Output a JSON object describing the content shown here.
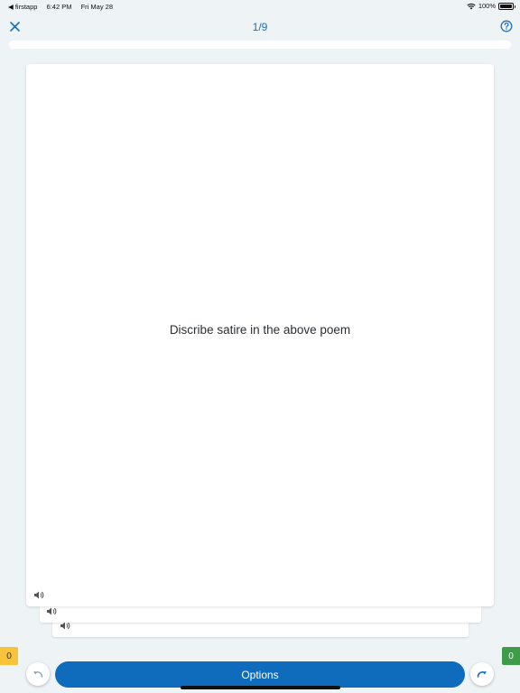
{
  "status_bar": {
    "back_app": "◀ firstapp",
    "time": "6:42 PM",
    "date": "Fri May 28",
    "battery": "100%"
  },
  "header": {
    "counter": "1/9",
    "close_icon": "close-icon",
    "help_icon": "help-circle-icon"
  },
  "progress": {
    "fraction": 0.11
  },
  "card": {
    "text": "Discribe satire in the above poem",
    "audio_icon": "speaker-icon"
  },
  "footer": {
    "score_left": "0",
    "score_right": "0",
    "options_label": "Options",
    "undo_icon": "undo-icon",
    "redo_icon": "redo-icon"
  },
  "colors": {
    "accent": "#0f6cbd",
    "background": "#eef3f6",
    "score_left_bg": "#f6c33b",
    "score_right_bg": "#3f9b4a"
  }
}
